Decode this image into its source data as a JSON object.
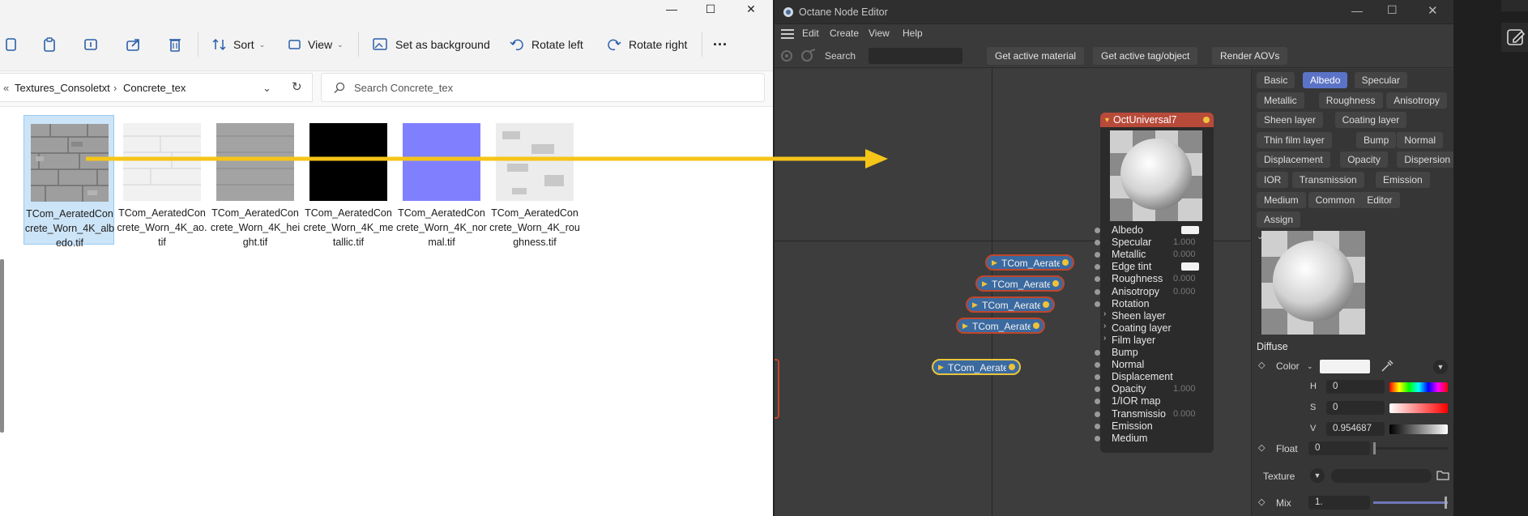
{
  "explorer": {
    "window_controls": {
      "minimize": "—",
      "maximize": "☐",
      "close": "✕"
    },
    "toolbar": {
      "sort_label": "Sort",
      "view_label": "View",
      "set_background_label": "Set as background",
      "rotate_left_label": "Rotate left",
      "rotate_right_label": "Rotate right",
      "more_label": "···"
    },
    "address": {
      "overflow": "«",
      "crumbs": [
        "Textures_Consoletxt",
        "Concrete_tex"
      ],
      "separator": "›"
    },
    "search": {
      "placeholder": "Search Concrete_tex"
    },
    "files": [
      {
        "name": "TCom_AeratedConcrete_Worn_4K_albedo.tif",
        "thumb": "albedo",
        "selected": true
      },
      {
        "name": "TCom_AeratedConcrete_Worn_4K_ao.tif",
        "thumb": "ao",
        "selected": false
      },
      {
        "name": "TCom_AeratedConcrete_Worn_4K_height.tif",
        "thumb": "height",
        "selected": false
      },
      {
        "name": "TCom_AeratedConcrete_Worn_4K_metallic.tif",
        "thumb": "metallic",
        "selected": false
      },
      {
        "name": "TCom_AeratedConcrete_Worn_4K_normal.tif",
        "thumb": "normal",
        "selected": false
      },
      {
        "name": "TCom_AeratedConcrete_Worn_4K_roughness.tif",
        "thumb": "roughness",
        "selected": false
      }
    ],
    "arrow_color": "#f5c518"
  },
  "octane": {
    "title": "Octane Node Editor",
    "menu": [
      "Edit",
      "Create",
      "View",
      "Help"
    ],
    "toolbar": {
      "search_label": "Search",
      "buttons": [
        "Get active material",
        "Get active tag/object",
        "Render AOVs"
      ]
    },
    "texture_nodes": [
      "TCom_Aeratec",
      "TCom_Aeratec",
      "TCom_Aeratec",
      "TCom_Aeratec",
      "TCom_Aeratec"
    ],
    "material_node": {
      "title": "OctUniversal7",
      "pins": [
        {
          "name": "Albedo",
          "swatch": true
        },
        {
          "name": "Specular",
          "value": "1.000"
        },
        {
          "name": "Metallic",
          "value": "0.000"
        },
        {
          "name": "Edge tint",
          "swatch": true
        },
        {
          "name": "Roughness",
          "value": "0.000"
        },
        {
          "name": "Anisotropy",
          "value": "0.000"
        },
        {
          "name": "Rotation"
        },
        {
          "name": "Sheen layer",
          "group": true
        },
        {
          "name": "Coating layer",
          "group": true
        },
        {
          "name": "Film layer",
          "group": true
        },
        {
          "name": "Bump"
        },
        {
          "name": "Normal"
        },
        {
          "name": "Displacement"
        },
        {
          "name": "Opacity",
          "value": "1.000"
        },
        {
          "name": "1/IOR map"
        },
        {
          "name": "Transmissio",
          "value": "0.000"
        },
        {
          "name": "Emission"
        },
        {
          "name": "Medium"
        }
      ]
    },
    "tabs": [
      [
        "Basic",
        "Albedo",
        "Specular"
      ],
      [
        "Metallic",
        "Roughness",
        "Anisotropy"
      ],
      [
        "Sheen layer",
        "Coating layer"
      ],
      [
        "Thin film layer",
        "Bump",
        "Normal"
      ],
      [
        "Displacement",
        "Opacity",
        "Dispersion"
      ],
      [
        "IOR",
        "Transmission",
        "Emission"
      ],
      [
        "Medium",
        "Common",
        "Editor"
      ],
      [
        "Assign"
      ]
    ],
    "active_tab": "Albedo",
    "properties": {
      "section": "Diffuse",
      "color_label": "Color",
      "h_label": "H",
      "h_value": "0",
      "s_label": "S",
      "s_value": "0",
      "v_label": "V",
      "v_value": "0.954687",
      "float_label": "Float",
      "float_value": "0",
      "texture_label": "Texture",
      "mix_label": "Mix",
      "mix_value": "1."
    }
  }
}
